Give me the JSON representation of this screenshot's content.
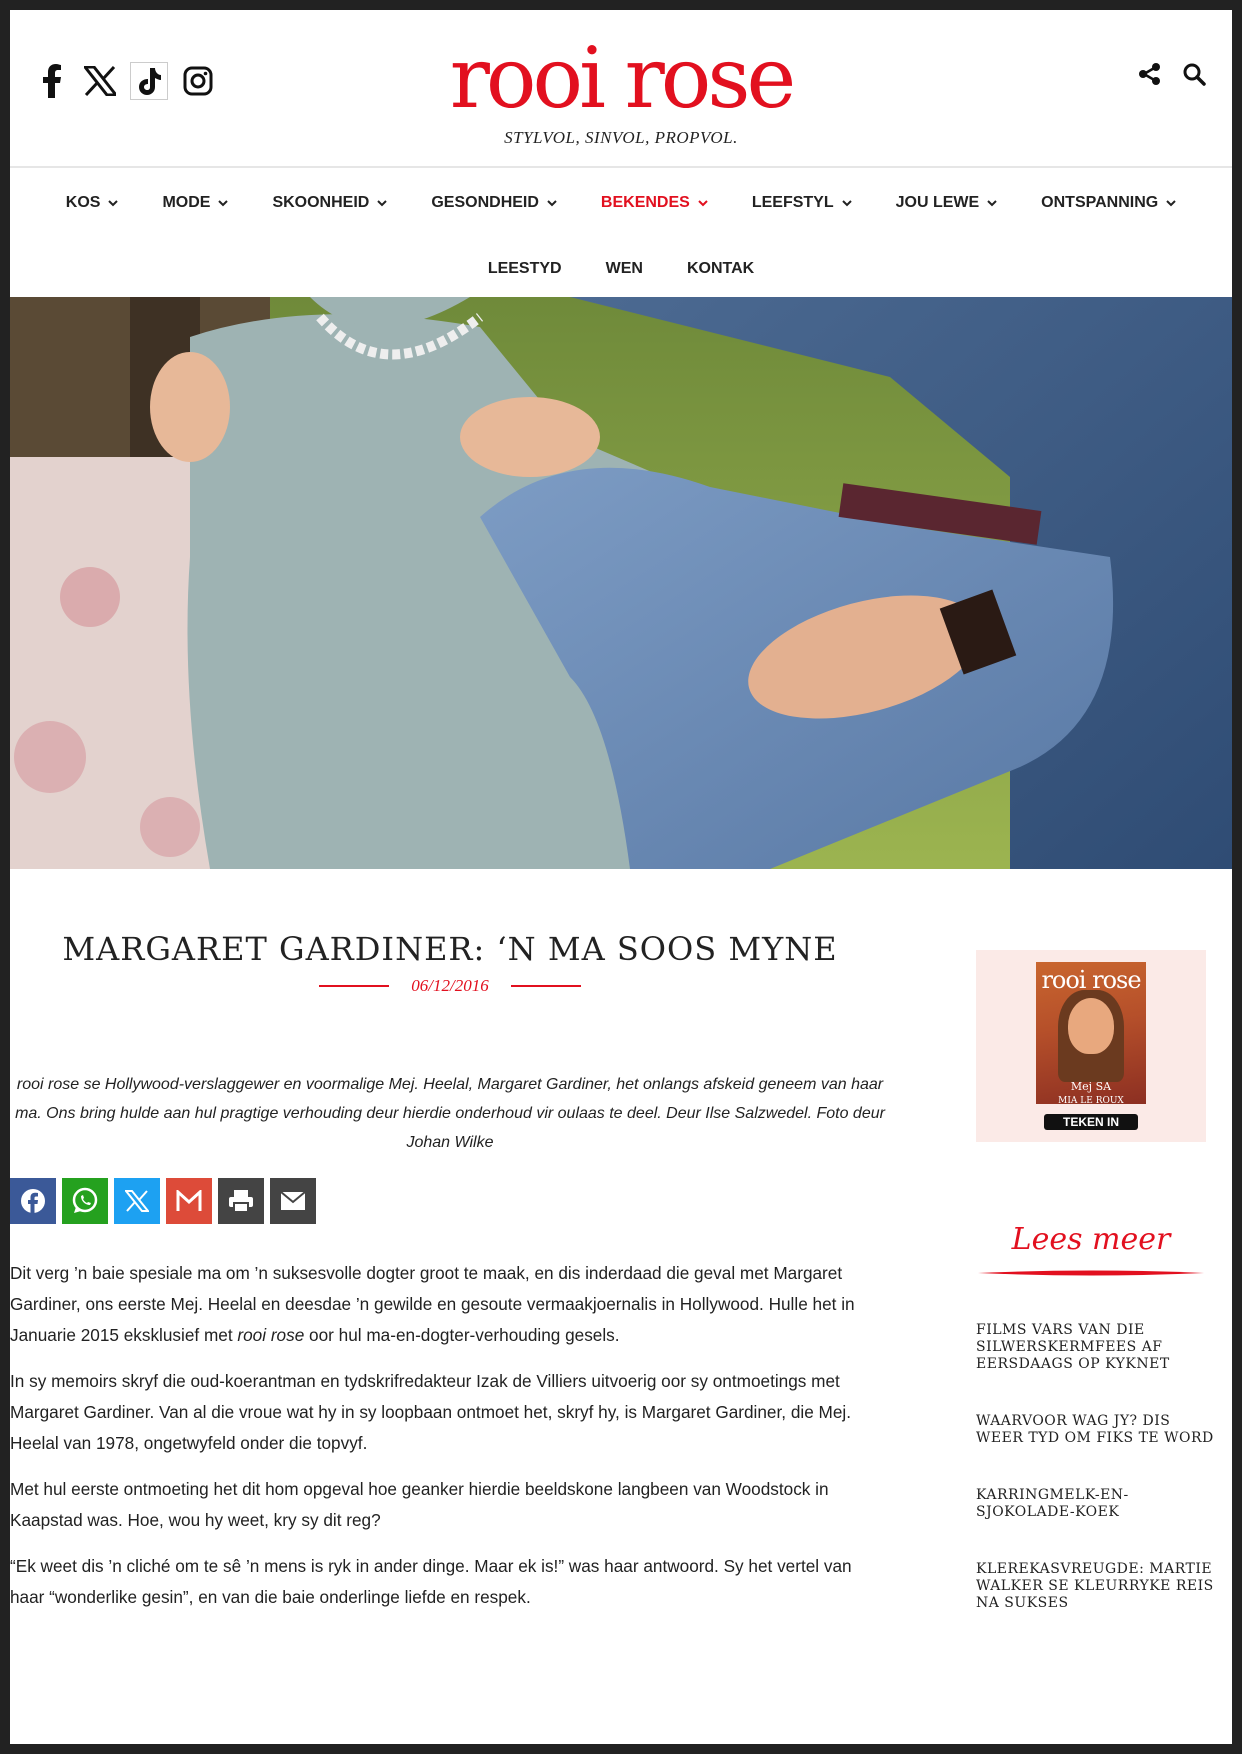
{
  "header": {
    "logo": "rooi rose",
    "tagline": "STYLVOL, SINVOL, PROPVOL.",
    "social_icons": [
      "facebook-icon",
      "x-icon",
      "tiktok-icon",
      "instagram-icon"
    ],
    "tools": [
      "share-icon",
      "search-icon"
    ]
  },
  "nav": {
    "row1": [
      {
        "label": "KOS",
        "dropdown": true
      },
      {
        "label": "MODE",
        "dropdown": true
      },
      {
        "label": "SKOONHEID",
        "dropdown": true
      },
      {
        "label": "GESONDHEID",
        "dropdown": true
      },
      {
        "label": "BEKENDES",
        "dropdown": true,
        "active": true
      },
      {
        "label": "LEEFSTYL",
        "dropdown": true
      },
      {
        "label": "JOU LEWE",
        "dropdown": true
      },
      {
        "label": "ONTSPANNING",
        "dropdown": true
      }
    ],
    "row2": [
      {
        "label": "LEESTYD"
      },
      {
        "label": "WEN"
      },
      {
        "label": "KONTAK"
      }
    ]
  },
  "article": {
    "title": "MARGARET GARDINER: ‘N MA SOOS MYNE",
    "date": "06/12/2016",
    "intro": "rooi rose se Hollywood-verslaggewer en voormalige Mej. Heelal, Margaret Gardiner, het onlangs afskeid geneem van haar ma. Ons bring hulde aan hul pragtige verhouding deur hierdie onderhoud vir oulaas te deel. Deur Ilse Salzwedel. Foto deur Johan Wilke",
    "share_buttons": [
      "facebook",
      "whatsapp",
      "x",
      "gmail",
      "print",
      "email"
    ],
    "p1_a": "Dit verg ’n  baie spesiale ma om ’n  suksesvolle dogter groot te maak, en dis inderdaad die geval met Margaret Gardiner, ons eerste Mej. Heelal en deesdae ’n gewilde en gesoute vermaakjoernalis in Hollywood. Hulle het in Januarie 2015 eksklusief met ",
    "p1_em": "rooi rose",
    "p1_b": " oor hul ma-en-dogter-verhouding gesels.",
    "p2": "In sy memoirs skryf die oud-koerantman en tydskrifredakteur Izak de Villiers uitvoerig oor sy ontmoetings met Margaret Gardiner. Van al die vroue wat hy in sy loopbaan ontmoet het, skryf hy, is Margaret Gardiner, die Mej. Heelal van 1978, ongetwyfeld onder die topvyf.",
    "p3": "Met hul eerste ontmoeting het dit hom opgeval hoe geanker hierdie beeldskone langbeen van Woodstock in Kaapstad was. Hoe, wou hy weet, kry sy dit reg?",
    "p4": "“Ek weet dis ’n cliché om te sê ’n mens is ryk in ander dinge. Maar ek is!” was haar antwoord. Sy het vertel van haar “wonderlike gesin”, en van die baie onderlinge liefde en respek."
  },
  "sidebar": {
    "magazine": {
      "cover_logo": "rooi rose",
      "cover_text": "Mej SA",
      "cover_name": "MIA LE ROUX",
      "button": "TEKEN IN"
    },
    "lees_meer": "Lees meer",
    "links": [
      "FILMS VARS VAN DIE SILWERSKERMFEES AF EERSDAAGS OP KYKNET",
      "WAARVOOR WAG JY? DIS WEER TYD OM FIKS TE WORD",
      "KARRINGMELK-EN-SJOKOLADE-KOEK",
      "KLEREKASVREUGDE: MARTIE WALKER SE KLEURRYKE REIS NA SUKSES"
    ]
  },
  "colors": {
    "brand_red": "#e2101f",
    "facebook": "#3b5998",
    "whatsapp": "#25a11f",
    "x": "#1da1f2",
    "gmail": "#dd4b39",
    "print": "#444444",
    "email": "#444444"
  }
}
